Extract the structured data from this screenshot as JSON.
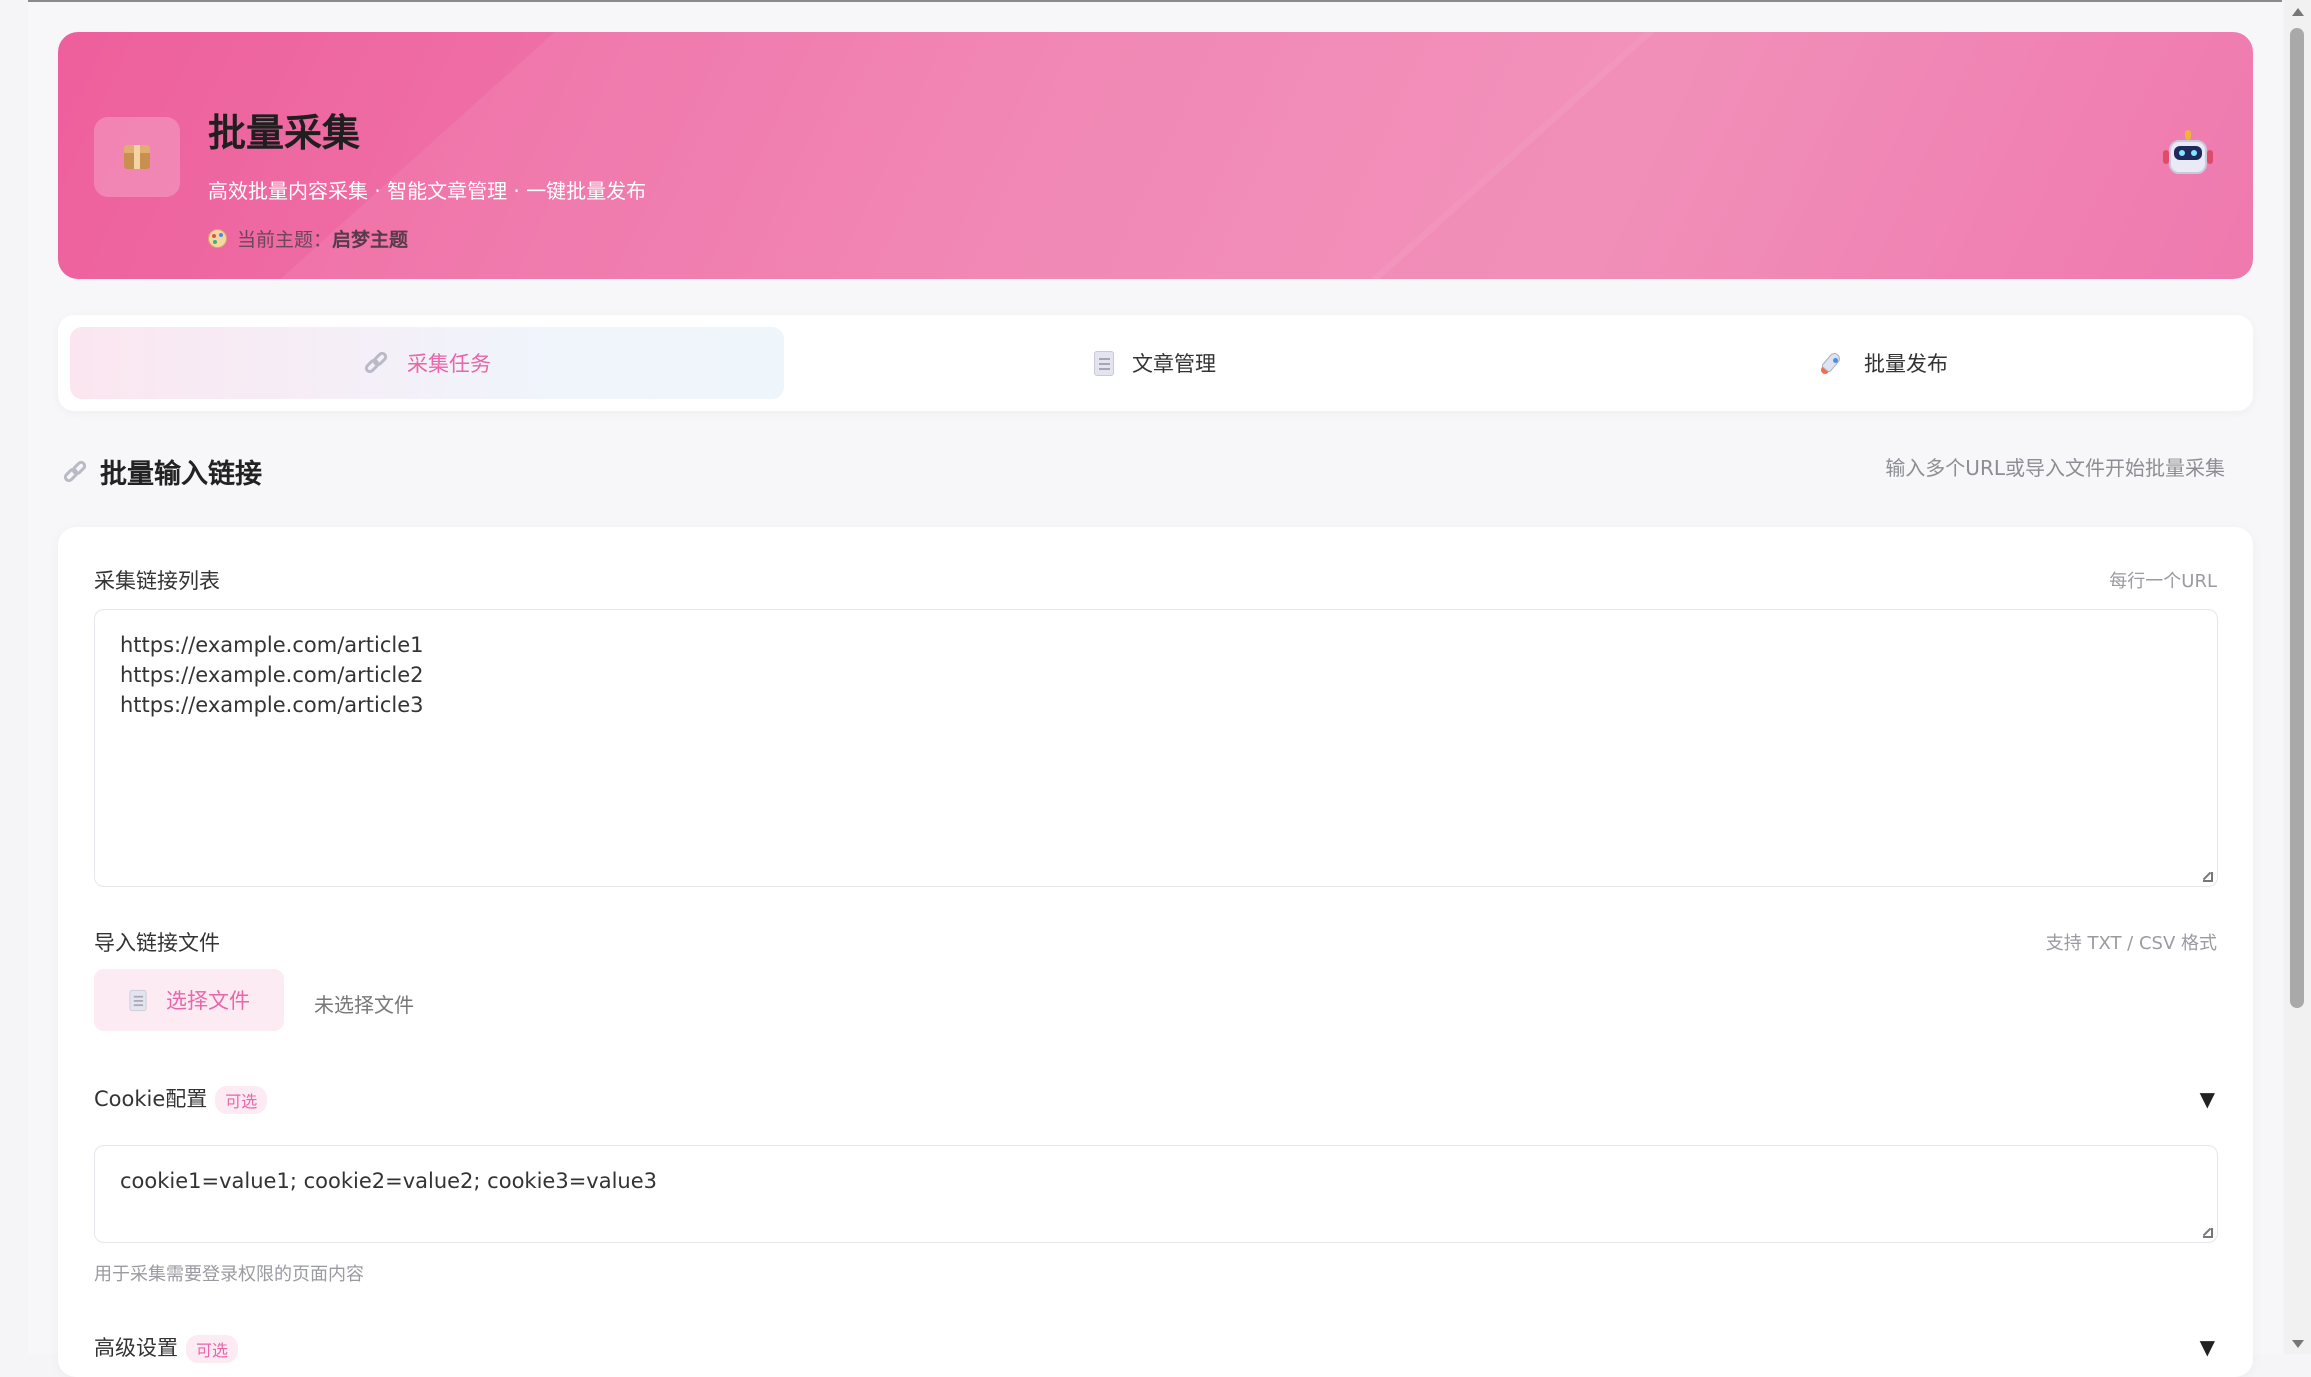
{
  "header": {
    "title": "批量采集",
    "subtitle": "高效批量内容采集 · 智能文章管理 · 一键批量发布",
    "theme_label": "当前主题：",
    "theme_name": "启梦主题",
    "icon": "package-icon",
    "avatar_icon": "robot-icon"
  },
  "tabs": [
    {
      "label": "采集任务",
      "icon": "link-icon",
      "active": true
    },
    {
      "label": "文章管理",
      "icon": "document-icon",
      "active": false
    },
    {
      "label": "批量发布",
      "icon": "rocket-icon",
      "active": false
    }
  ],
  "section": {
    "title": "批量输入链接",
    "hint": "输入多个URL或导入文件开始批量采集"
  },
  "form": {
    "urls_label": "采集链接列表",
    "urls_hint": "每行一个URL",
    "urls": [
      "https://example.com/article1",
      "https://example.com/article2",
      "https://example.com/article3"
    ],
    "import_label": "导入链接文件",
    "import_hint": "支持 TXT / CSV 格式",
    "file_button": "选择文件",
    "no_file": "未选择文件",
    "cookie_label": "Cookie配置",
    "cookie_badge": "可选",
    "cookie_value": "cookie1=value1; cookie2=value2; cookie3=value3",
    "cookie_help": "用于采集需要登录权限的页面内容",
    "advanced_label": "高级设置",
    "advanced_badge": "可选",
    "collapse_symbol": "▼"
  },
  "colors": {
    "accent": "#e866a9",
    "hero_start": "#ee5f9c",
    "hero_end": "#f18ab6"
  }
}
